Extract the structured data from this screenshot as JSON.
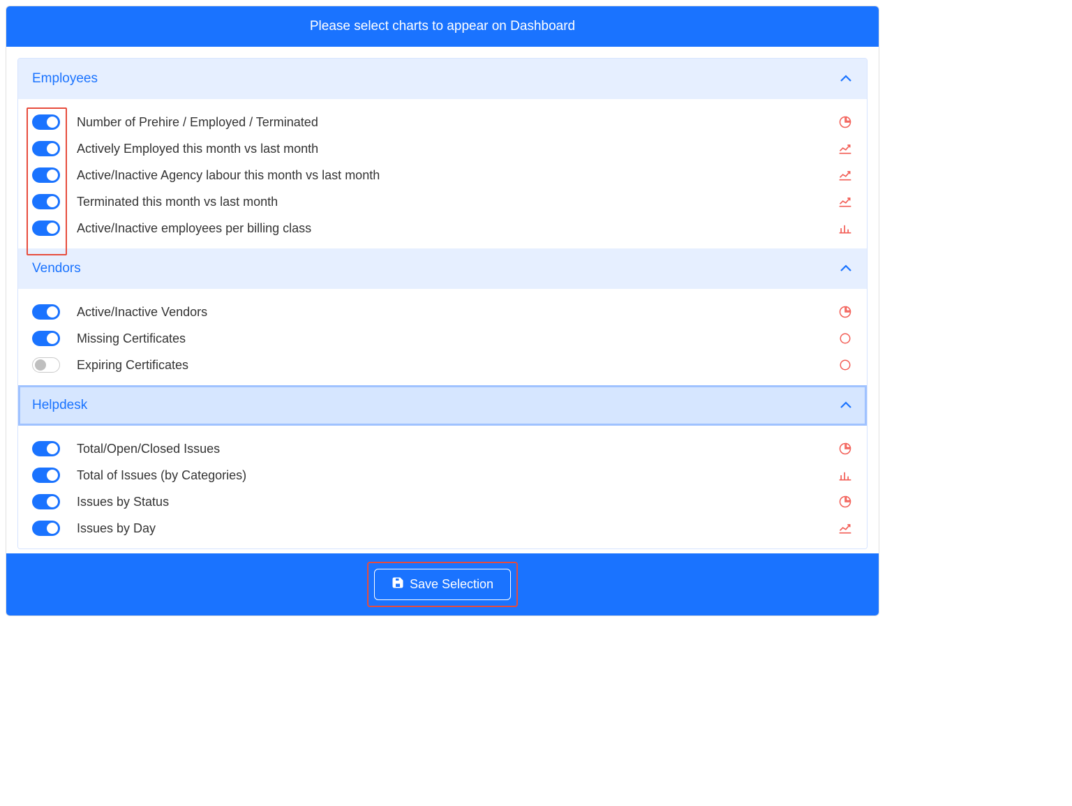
{
  "header": {
    "title": "Please select charts to appear on Dashboard"
  },
  "sections": [
    {
      "key": "employees",
      "title": "Employees",
      "expanded": true,
      "selected": false,
      "highlightToggles": true,
      "rows": [
        {
          "label": "Number of Prehire / Employed / Terminated",
          "on": true,
          "icon": "pie"
        },
        {
          "label": "Actively Employed this month vs last month",
          "on": true,
          "icon": "line"
        },
        {
          "label": "Active/Inactive Agency labour this month vs last month",
          "on": true,
          "icon": "line"
        },
        {
          "label": "Terminated this month vs last month",
          "on": true,
          "icon": "line"
        },
        {
          "label": "Active/Inactive employees per billing class",
          "on": true,
          "icon": "bar"
        }
      ]
    },
    {
      "key": "vendors",
      "title": "Vendors",
      "expanded": true,
      "selected": false,
      "highlightToggles": false,
      "rows": [
        {
          "label": "Active/Inactive Vendors",
          "on": true,
          "icon": "pie"
        },
        {
          "label": "Missing Certificates",
          "on": true,
          "icon": "circle"
        },
        {
          "label": "Expiring Certificates",
          "on": false,
          "icon": "circle"
        }
      ]
    },
    {
      "key": "helpdesk",
      "title": "Helpdesk",
      "expanded": true,
      "selected": true,
      "highlightToggles": false,
      "rows": [
        {
          "label": "Total/Open/Closed Issues",
          "on": true,
          "icon": "pie"
        },
        {
          "label": "Total of Issues (by Categories)",
          "on": true,
          "icon": "bar"
        },
        {
          "label": "Issues by Status",
          "on": true,
          "icon": "pie"
        },
        {
          "label": "Issues by Day",
          "on": true,
          "icon": "line"
        }
      ]
    }
  ],
  "footer": {
    "save_label": "Save Selection",
    "highlight": true
  },
  "colors": {
    "primary": "#1a73ff",
    "icon": "#f25c54",
    "annotation": "#e74c3c"
  }
}
